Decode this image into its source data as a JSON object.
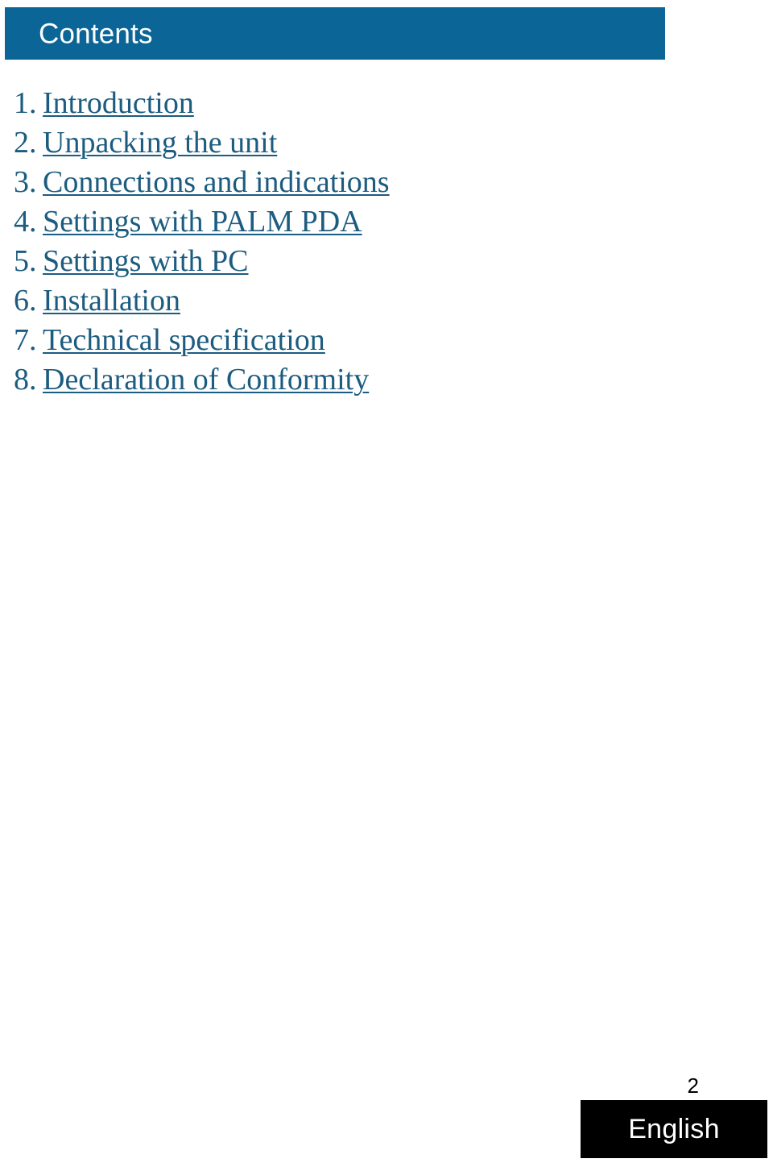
{
  "header": {
    "title": "Contents",
    "background_color": "#0b6596",
    "text_color": "#ffffff"
  },
  "toc": {
    "link_color": "#1c5c80",
    "items": [
      {
        "number": "1.",
        "label": "Introduction"
      },
      {
        "number": "2.",
        "label": "Unpacking the unit"
      },
      {
        "number": "3.",
        "label": "Connections and indications"
      },
      {
        "number": "4.",
        "label": "Settings with PALM PDA"
      },
      {
        "number": "5.",
        "label": "Settings with PC"
      },
      {
        "number": "6.",
        "label": "Installation"
      },
      {
        "number": "7.",
        "label": "Technical specification"
      },
      {
        "number": "8.",
        "label": "Declaration of Conformity"
      }
    ]
  },
  "footer": {
    "page_number": "2",
    "language": "English",
    "language_box_color": "#000000",
    "language_text_color": "#ffffff"
  }
}
